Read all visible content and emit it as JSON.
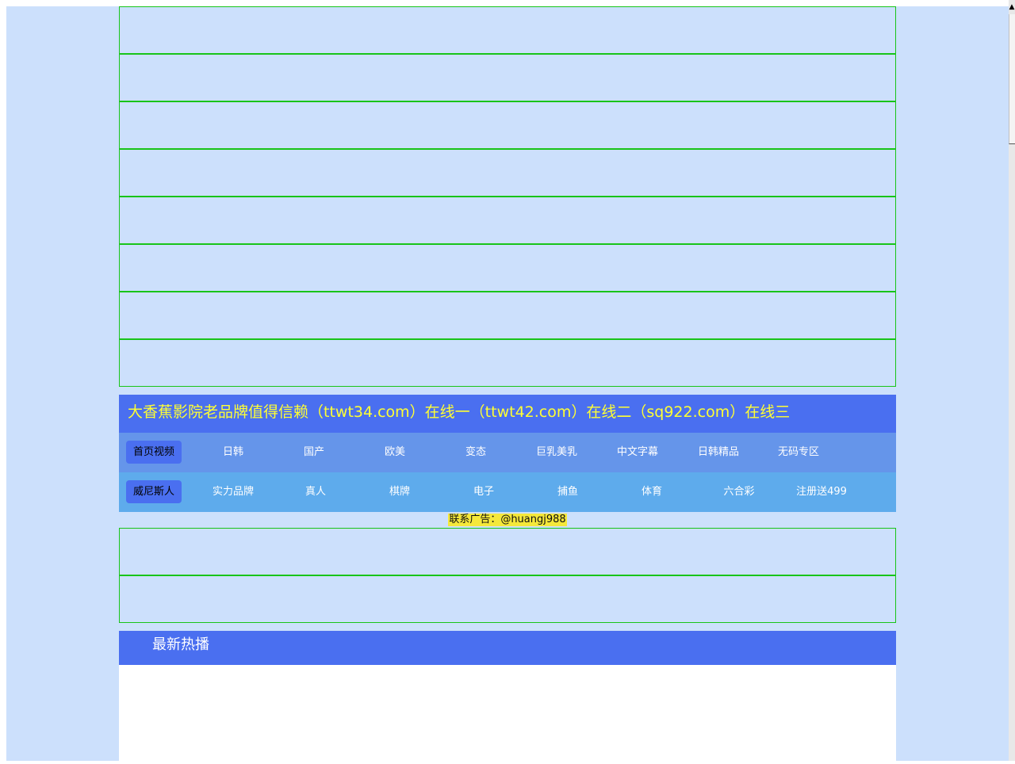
{
  "site": {
    "title": "大香蕉影院老品牌值得信赖（ttwt34.com）在线一（ttwt42.com）在线二（sq922.com）在线三"
  },
  "nav_row_1": {
    "home_label": "首页视频",
    "items": [
      "日韩",
      "国产",
      "欧美",
      "变态",
      "巨乳美乳",
      "中文字幕",
      "日韩精品",
      "无码专区"
    ]
  },
  "nav_row_2": {
    "home_label": "威尼斯人",
    "items": [
      "实力品牌",
      "真人",
      "棋牌",
      "电子",
      "捕鱼",
      "体育",
      "六合彩",
      "注册送499"
    ]
  },
  "contact": {
    "text": "联系广告：@huangj988"
  },
  "latest": {
    "header": "最新热播"
  },
  "colors": {
    "page_background": "#cce0fc",
    "ad_border": "#18c418",
    "title_bar": "#4a6ff0",
    "title_text": "#ffff33",
    "nav_row_1": "#6595ea",
    "nav_row_2": "#5eabec",
    "contact_highlight": "#f5e83a"
  }
}
